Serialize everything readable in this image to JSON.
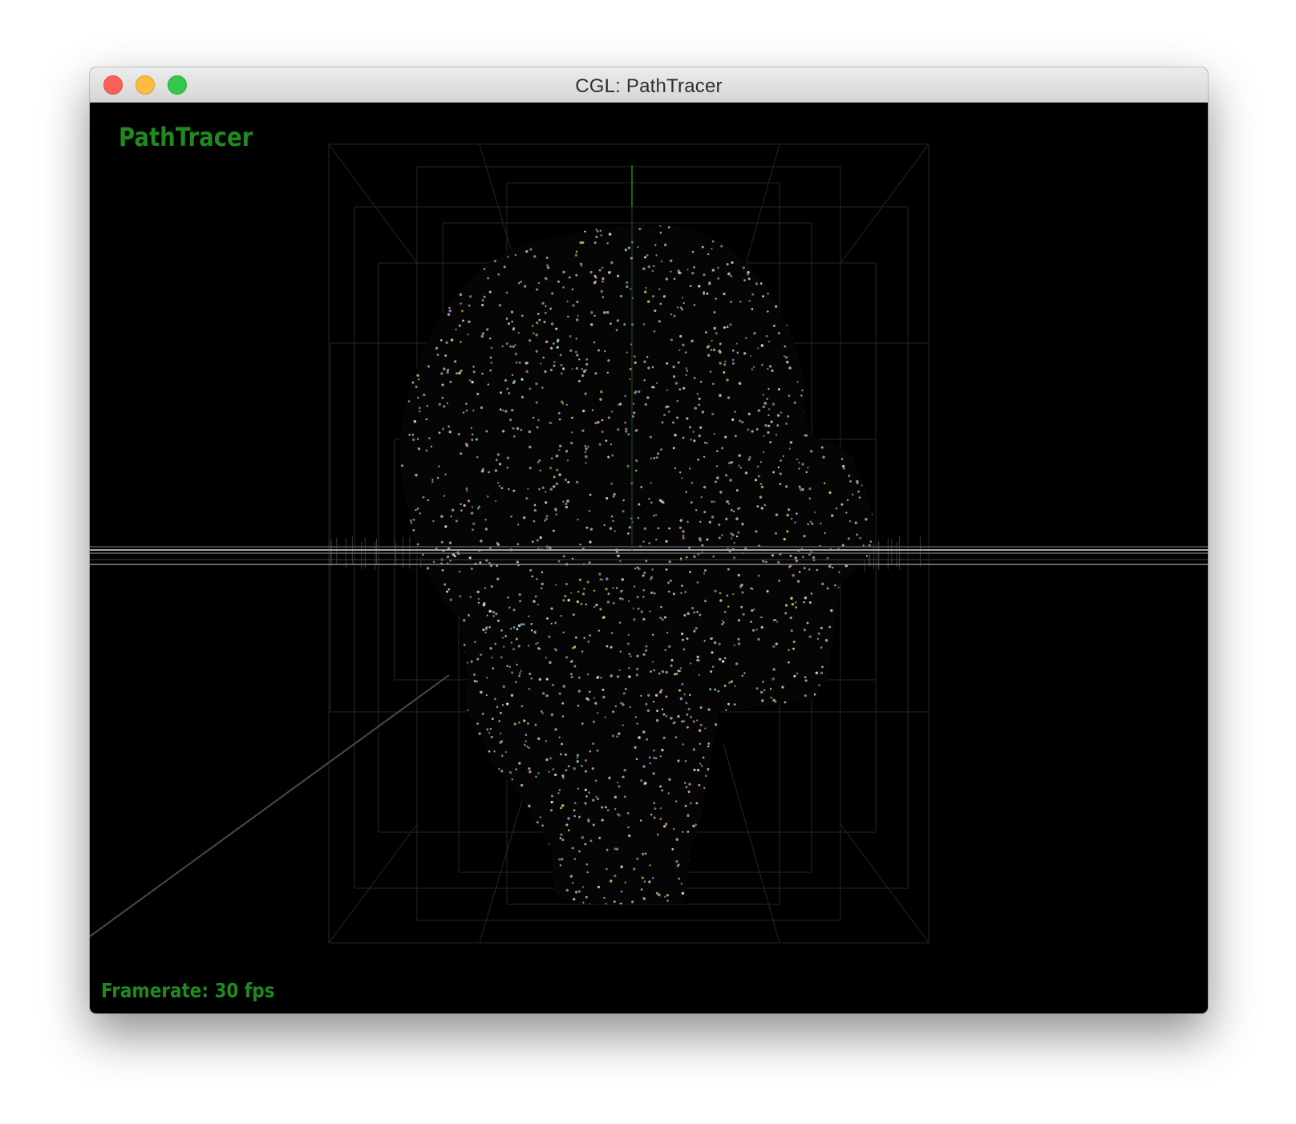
{
  "window": {
    "title": "CGL: PathTracer"
  },
  "overlay": {
    "app_title": "PathTracer",
    "framerate": "Framerate: 30 fps"
  },
  "colors": {
    "overlay_text": "#1f8a1f",
    "background": "#000000",
    "ground_line": "#8a8a8a",
    "bvh_box": "#2a2a2a",
    "vertical_axis": "#1f8a1f"
  },
  "scene": {
    "model": "head point cloud",
    "overlays": [
      "bvh-wireframe",
      "ground-plane",
      "vertical-axis"
    ]
  }
}
